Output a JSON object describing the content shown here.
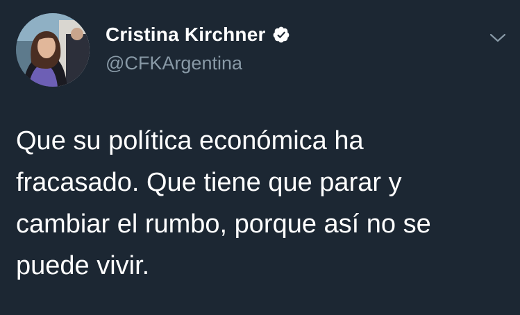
{
  "tweet": {
    "author": {
      "display_name": "Cristina Kirchner",
      "handle": "@CFKArgentina",
      "verified": true
    },
    "text_lines": [
      "Que su política económica ha",
      "fracasado. Que tiene que parar y",
      "cambiar el rumbo, porque así no se",
      "puede vivir."
    ]
  },
  "icons": {
    "verified": "verified-badge-icon",
    "menu": "chevron-down-icon",
    "avatar": "profile-photo"
  },
  "colors": {
    "background": "#1c2733",
    "primary_text": "#ffffff",
    "secondary_text": "#8899a6",
    "caret": "#8899a6"
  }
}
